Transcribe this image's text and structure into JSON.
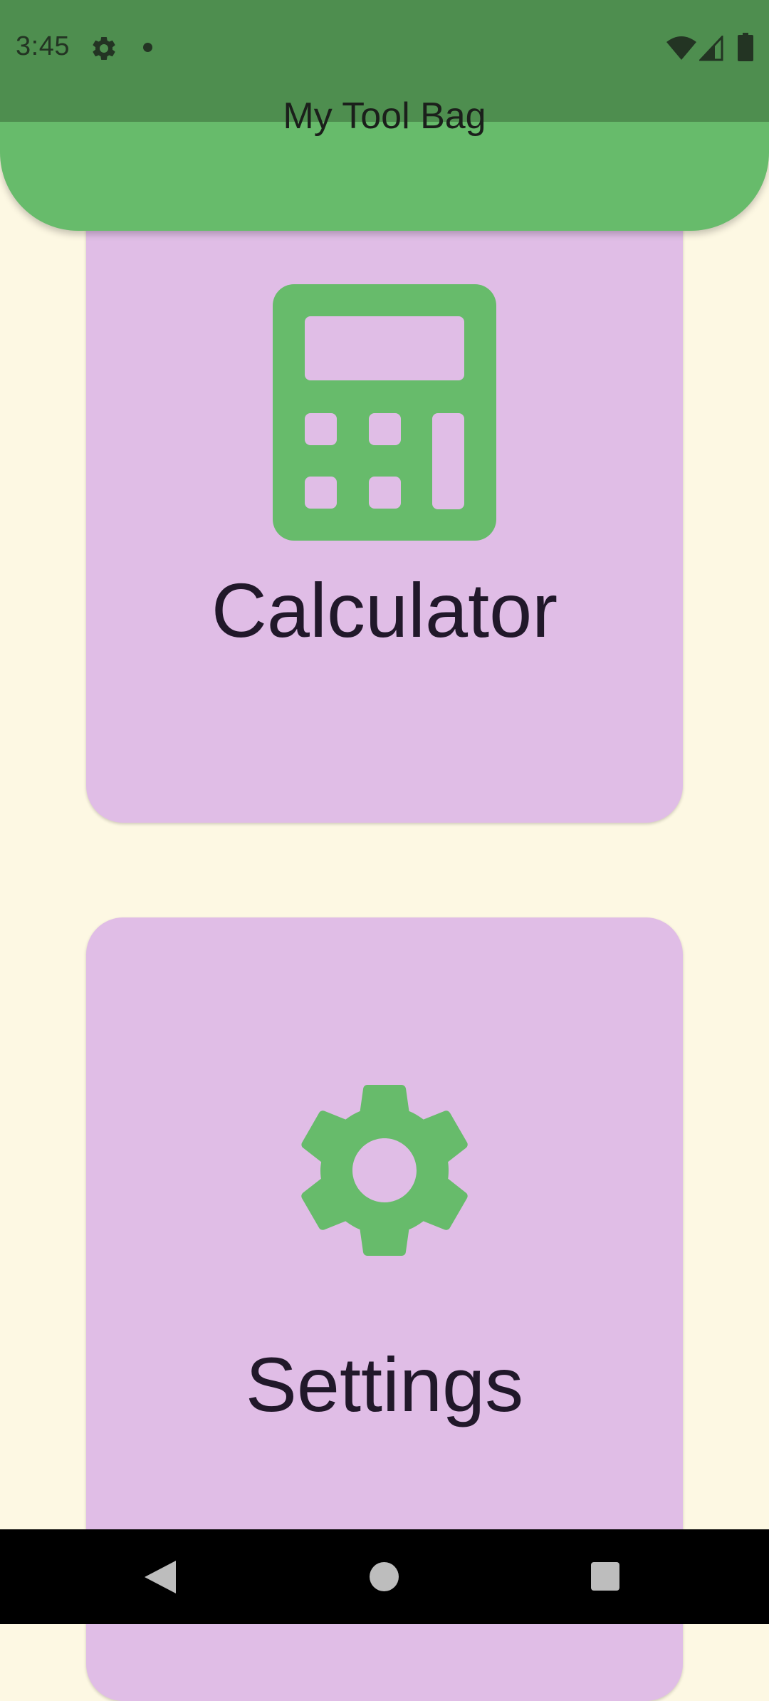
{
  "status_bar": {
    "time": "3:45",
    "icons": [
      "settings-gear-icon",
      "notification-dot-icon",
      "wifi-icon",
      "cellular-signal-icon",
      "battery-icon"
    ]
  },
  "app_bar": {
    "title": "My Tool Bag"
  },
  "tools": [
    {
      "label": "Calculator",
      "icon": "calculator-icon"
    },
    {
      "label": "Settings",
      "icon": "settings-icon"
    }
  ],
  "nav_bar": {
    "icons": [
      "back-icon",
      "home-icon",
      "recents-icon"
    ]
  },
  "colors": {
    "background": "#FDF8E3",
    "status_bar": "#4E8E4F",
    "app_bar": "#67BB6B",
    "card": "#E0BDE6",
    "icon": "#67BB6B",
    "text": "#21182A"
  }
}
